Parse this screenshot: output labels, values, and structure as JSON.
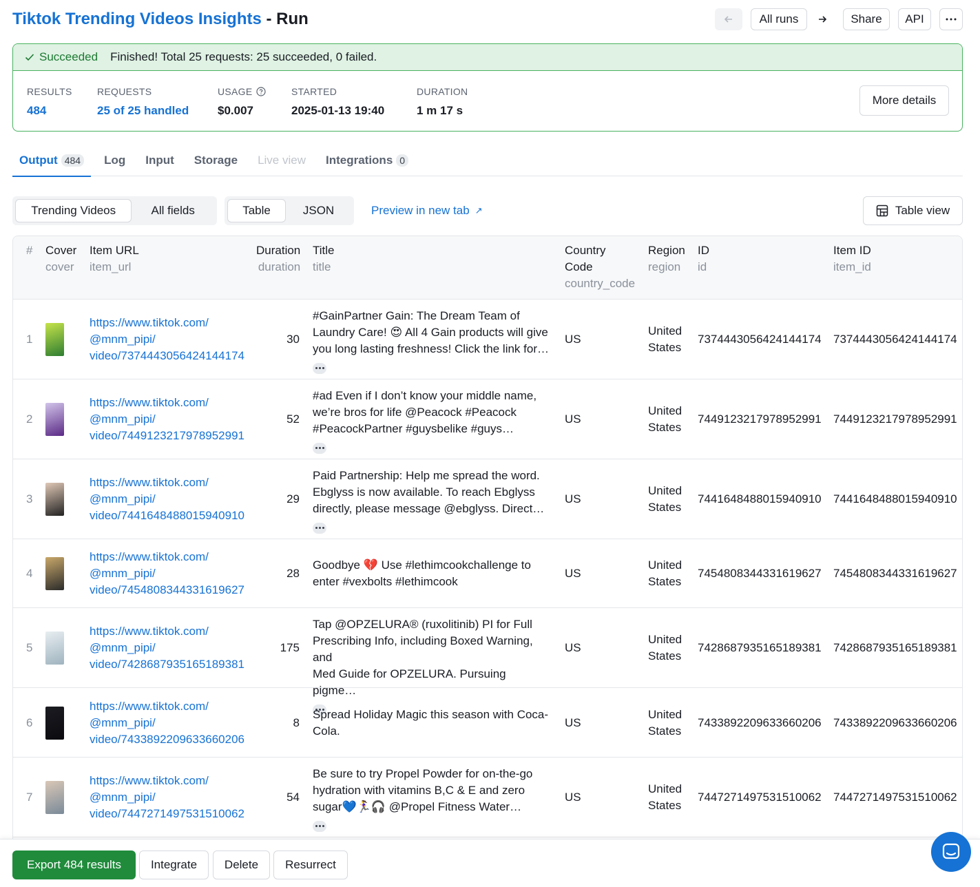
{
  "header": {
    "actor_name": "Tiktok Trending Videos Insights",
    "separator": " - ",
    "page_name": "Run",
    "all_runs_label": "All runs",
    "share_label": "Share",
    "api_label": "API",
    "more_label": "···"
  },
  "status": {
    "state": "Succeeded",
    "message": "Finished! Total 25 requests: 25 succeeded, 0 failed.",
    "colors": {
      "success_text": "#1e7a34",
      "success_bg": "#dff2e3",
      "success_border": "#49b25f"
    }
  },
  "stats": {
    "results_label": "RESULTS",
    "results_value": "484",
    "requests_label": "REQUESTS",
    "requests_value": "25 of 25 handled",
    "usage_label": "USAGE",
    "usage_value": "$0.007",
    "started_label": "STARTED",
    "started_value": "2025-01-13 19:40",
    "duration_label": "DURATION",
    "duration_value": "1 m 17 s",
    "more_details_label": "More details"
  },
  "tabs": [
    {
      "label": "Output",
      "badge": "484"
    },
    {
      "label": "Log"
    },
    {
      "label": "Input"
    },
    {
      "label": "Storage"
    },
    {
      "label": "Live view"
    },
    {
      "label": "Integrations",
      "badge": "0"
    }
  ],
  "toolbar": {
    "view_trending": "Trending Videos",
    "view_all_fields": "All fields",
    "format_table": "Table",
    "format_json": "JSON",
    "preview_label": "Preview in new tab",
    "table_view_label": "Table view"
  },
  "columns": {
    "num": "#",
    "cover": {
      "label": "Cover",
      "key": "cover"
    },
    "item_url": {
      "label": "Item URL",
      "key": "item_url"
    },
    "duration": {
      "label": "Duration",
      "key": "duration"
    },
    "title": {
      "label": "Title",
      "key": "title"
    },
    "country_code": {
      "label1": "Country",
      "label2": "Code",
      "key": "country_code"
    },
    "region": {
      "label": "Region",
      "key": "region"
    },
    "id": {
      "label": "ID",
      "key": "id"
    },
    "item_id": {
      "label": "Item ID",
      "key": "item_id"
    }
  },
  "rows": [
    {
      "num": "1",
      "url1": "https://www.tiktok.com/",
      "url2": "@mnm_pipi/",
      "url3": "video/7374443056424144174",
      "duration": "30",
      "title1": "#GainPartner Gain: The Dream Team of",
      "title2": "Laundry Care! 😍 All 4 Gain products will give",
      "title3": "you long lasting freshness! Click the link for…",
      "country": "US",
      "region1": "United",
      "region2": "States",
      "id": "7374443056424144174",
      "item_id": "7374443056424144174"
    },
    {
      "num": "2",
      "url1": "https://www.tiktok.com/",
      "url2": "@mnm_pipi/",
      "url3": "video/7449123217978952991",
      "duration": "52",
      "title1": "#ad Even if I don’t know your middle name,",
      "title2": "we’re bros for life @Peacock #Peacock",
      "title3": "#PeacockPartner #guysbelike #guys…",
      "country": "US",
      "region1": "United",
      "region2": "States",
      "id": "7449123217978952991",
      "item_id": "7449123217978952991"
    },
    {
      "num": "3",
      "url1": "https://www.tiktok.com/",
      "url2": "@mnm_pipi/",
      "url3": "video/7441648488015940910",
      "duration": "29",
      "title1": "Paid Partnership: Help me spread the word.",
      "title2": "Ebglyss is now available. To reach Ebglyss",
      "title3": "directly, please message @ebglyss. Direct…",
      "country": "US",
      "region1": "United",
      "region2": "States",
      "id": "7441648488015940910",
      "item_id": "7441648488015940910"
    },
    {
      "num": "4",
      "url1": "https://www.tiktok.com/",
      "url2": "@mnm_pipi/",
      "url3": "video/7454808344331619627",
      "duration": "28",
      "title1": "Goodbye 💔 Use #lethimcookchallenge to",
      "title2": "enter #vexbolts #lethimcook",
      "title3": "",
      "country": "US",
      "region1": "United",
      "region2": "States",
      "id": "7454808344331619627",
      "item_id": "7454808344331619627"
    },
    {
      "num": "5",
      "url1": "https://www.tiktok.com/",
      "url2": "@mnm_pipi/",
      "url3": "video/7428687935165189381",
      "duration": "175",
      "title1": "Tap @OPZELURA® (ruxolitinib) PI for Full",
      "title2": "Prescribing Info, including Boxed Warning, and",
      "title3": "Med Guide for OPZELURA. Pursuing pigme…",
      "country": "US",
      "region1": "United",
      "region2": "States",
      "id": "7428687935165189381",
      "item_id": "7428687935165189381"
    },
    {
      "num": "6",
      "url1": "https://www.tiktok.com/",
      "url2": "@mnm_pipi/",
      "url3": "video/7433892209633660206",
      "duration": "8",
      "title1": "Spread Holiday Magic this season with Coca-",
      "title2": "Cola.",
      "title3": "",
      "country": "US",
      "region1": "United",
      "region2": "States",
      "id": "7433892209633660206",
      "item_id": "7433892209633660206"
    },
    {
      "num": "7",
      "url1": "https://www.tiktok.com/",
      "url2": "@mnm_pipi/",
      "url3": "video/7447271497531510062",
      "duration": "54",
      "title1": "Be sure to try Propel Powder for on-the-go",
      "title2": "hydration with vitamins B,C & E and zero",
      "title3": "sugar💙🏃‍♀️🎧 @Propel Fitness Water…",
      "country": "US",
      "region1": "United",
      "region2": "States",
      "id": "7447271497531510062",
      "item_id": "7447271497531510062"
    }
  ],
  "footer": {
    "export_label": "Export 484 results",
    "integrate_label": "Integrate",
    "delete_label": "Delete",
    "resurrect_label": "Resurrect"
  },
  "colors": {
    "accent": "#1672d4",
    "export_green": "#1f8b3b"
  }
}
